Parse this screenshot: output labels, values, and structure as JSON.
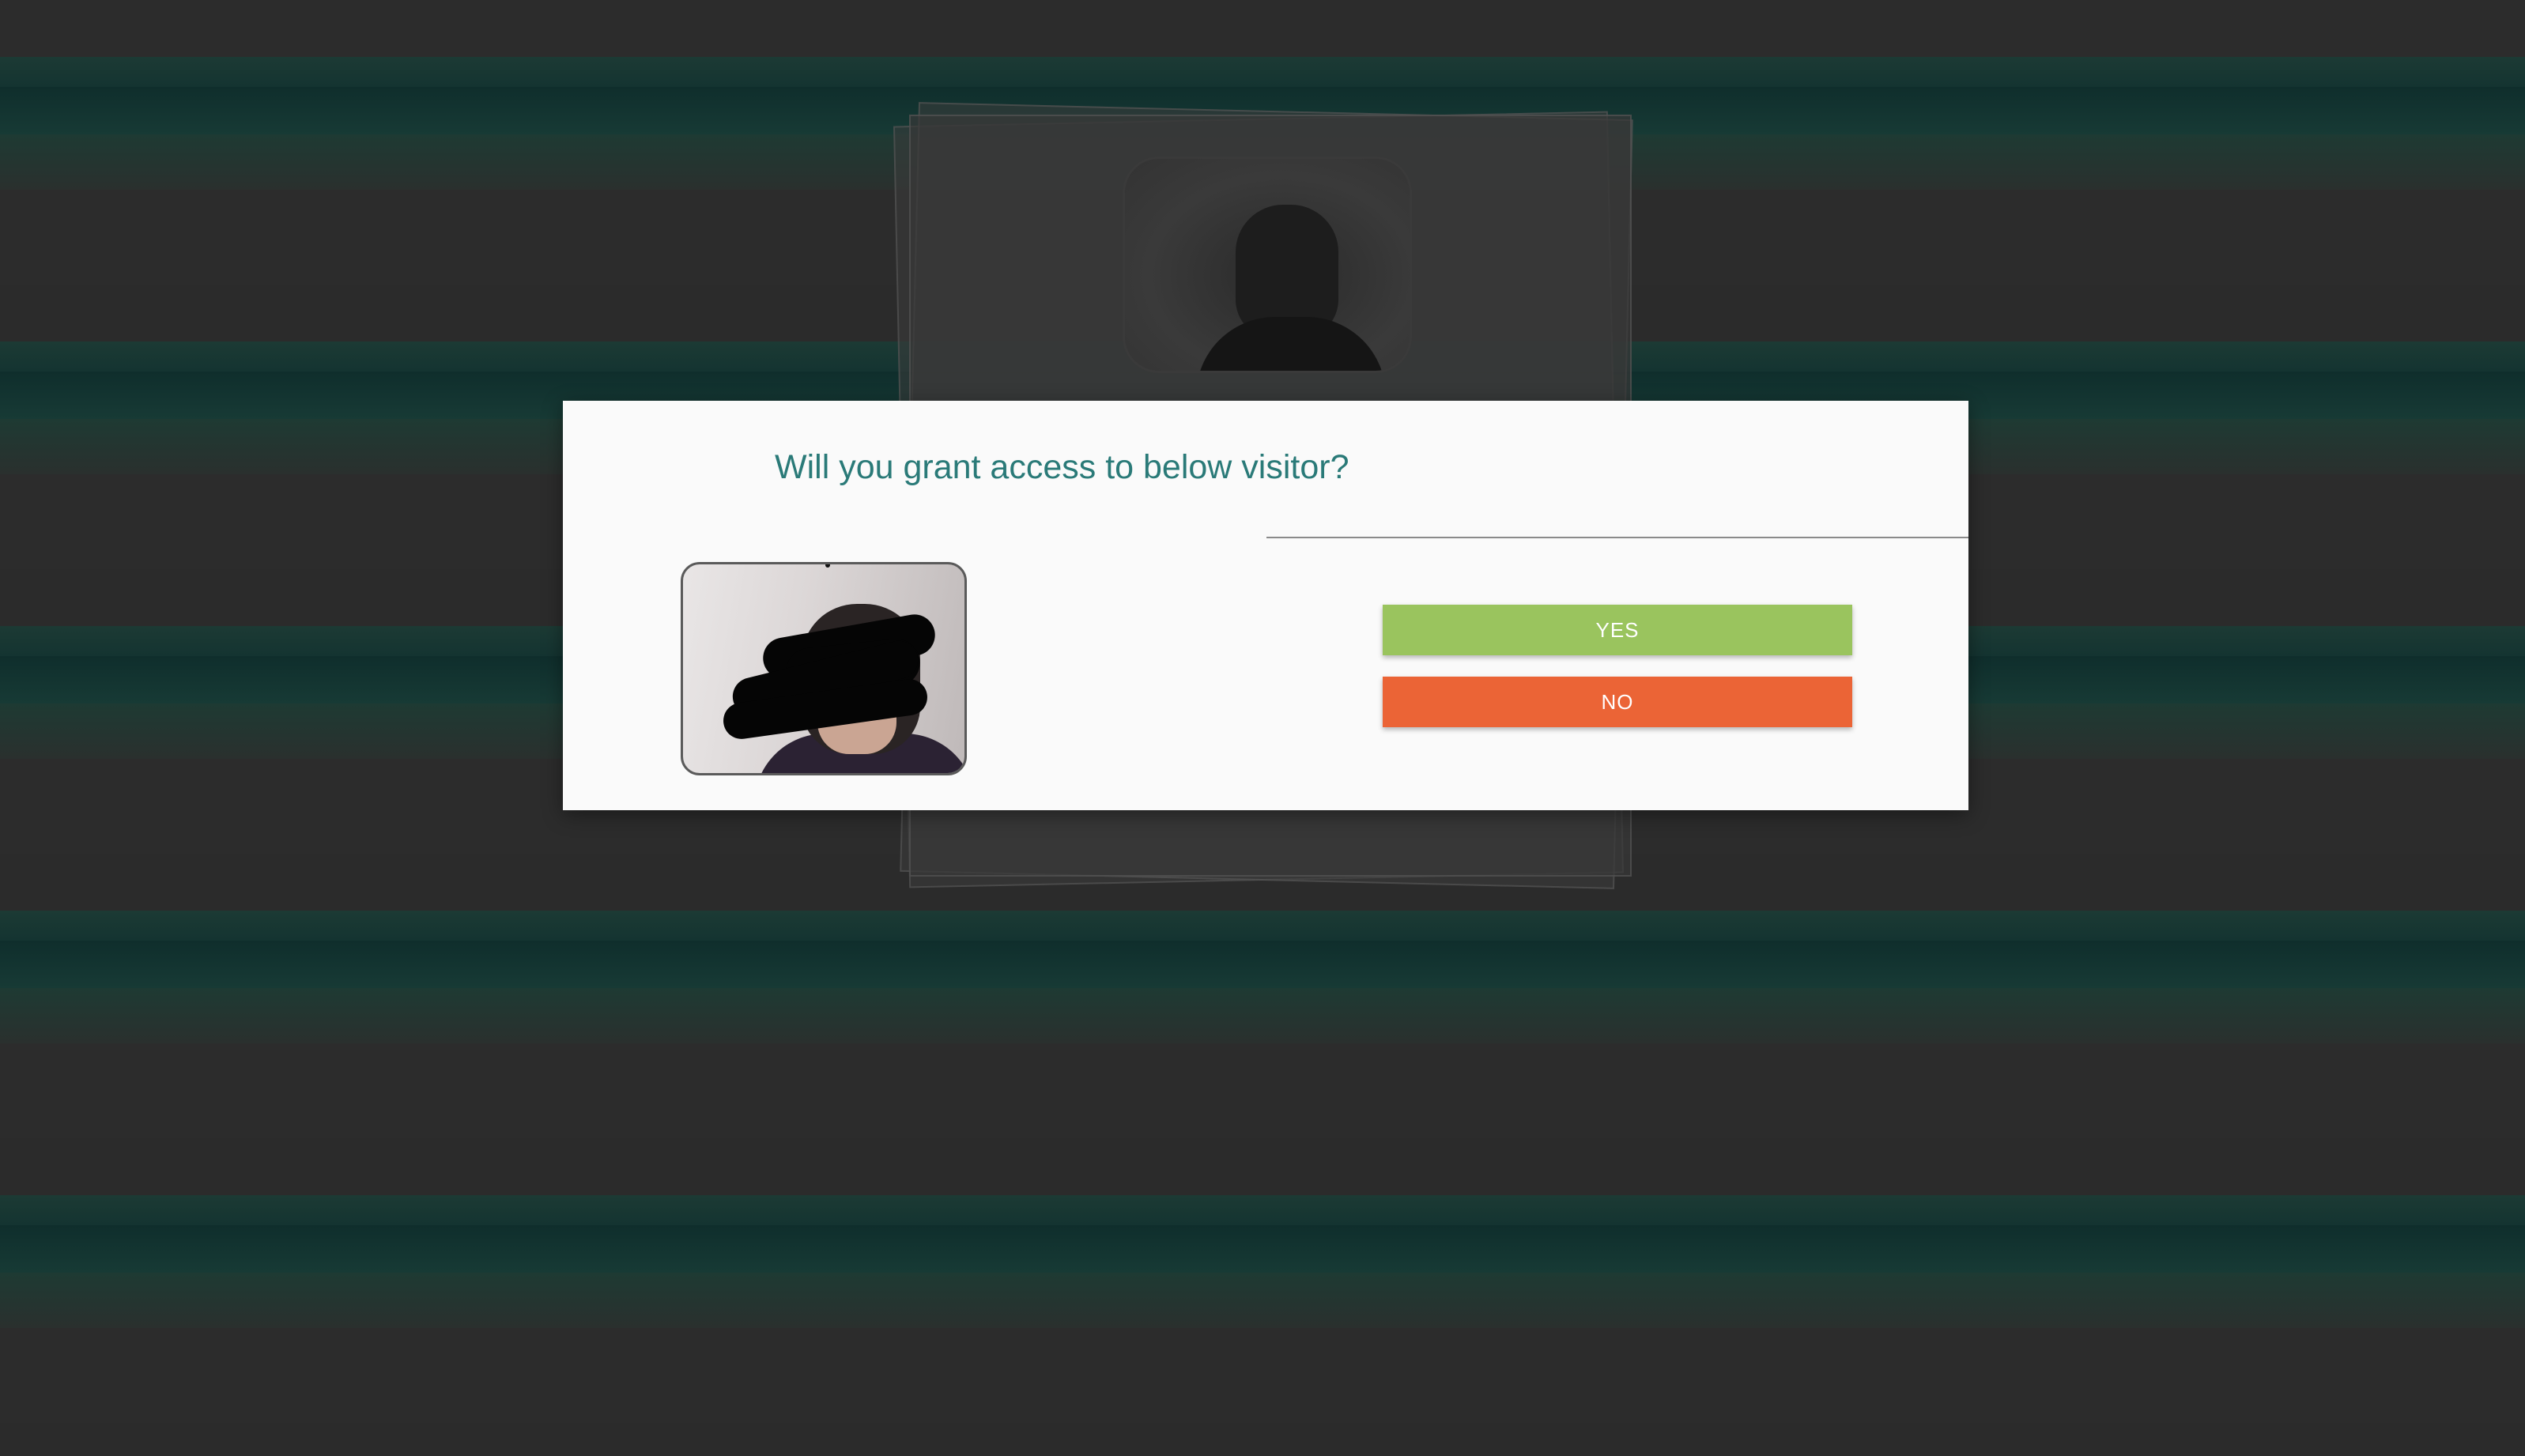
{
  "dialog": {
    "title": "Will you grant access to below visitor?",
    "yes_label": "YES",
    "no_label": "NO"
  },
  "colors": {
    "title": "#2a7a78",
    "yes_button": "#9ac45e",
    "no_button": "#eb6436",
    "modal_background": "#fafafa"
  },
  "icons": {
    "visitor_photo": "visitor-camera-snapshot",
    "background_photo": "background-camera-feed"
  }
}
